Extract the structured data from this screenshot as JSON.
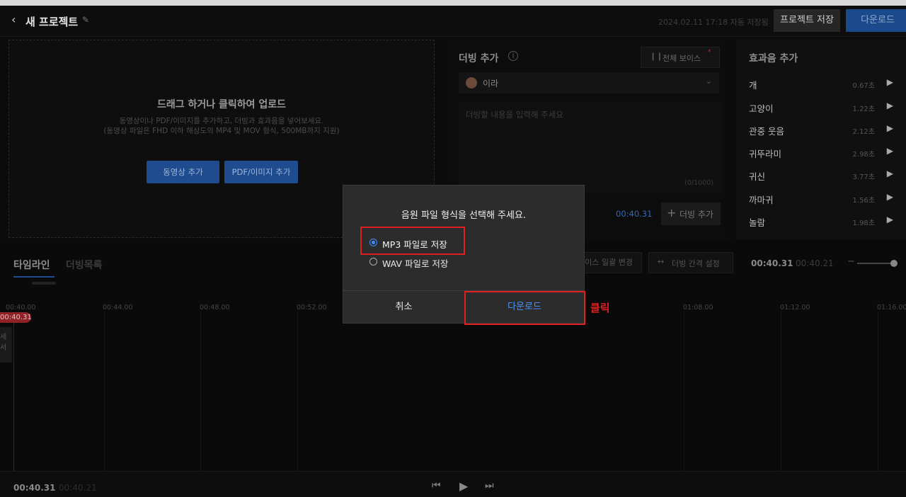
{
  "header": {
    "back_icon": "chevron-left-icon",
    "project_title": "새 프로젝트",
    "edit_icon": "pencil-icon",
    "autosave": "2024.02.11 17:18 자동 저장됨",
    "save_label": "프로젝트 저장",
    "download_label": "다운로드"
  },
  "upload": {
    "title": "드래그 하거나 클릭하여 업로드",
    "desc1": "동영상이나 PDF/이미지를 추가하고, 더빙과 효과음을 넣어보세요.",
    "desc2": "(동영상 파일은 FHD 이하 해상도의 MP4 및 MOV 형식, 500MB까지 지원)",
    "add_video": "동영상 추가",
    "add_pdf": "PDF/이미지 추가"
  },
  "dubbing": {
    "title": "더빙 추가",
    "info_icon": "info-icon",
    "all_voice": "전체 보이스",
    "voice_name": "이라",
    "placeholder": "더빙할 내용을 입력해 주세요",
    "counter": "(0/1000)",
    "time": "00:40.31",
    "add_label": "더빙 추가"
  },
  "sfx": {
    "title": "효과음 추가",
    "items": [
      {
        "name": "개",
        "dur": "0.67초"
      },
      {
        "name": "고양이",
        "dur": "1.22초"
      },
      {
        "name": "관중 웃음",
        "dur": "2.12초"
      },
      {
        "name": "귀뚜라미",
        "dur": "2.98초"
      },
      {
        "name": "귀신",
        "dur": "3.77초"
      },
      {
        "name": "까마귀",
        "dur": "1.56초"
      },
      {
        "name": "놀람",
        "dur": "1.98초"
      }
    ]
  },
  "timeline": {
    "tab_timeline": "타임라인",
    "tab_dublist": "더빙목록",
    "voice_bulk": "이스 일괄 변경",
    "interval": "더빙 간격 설정",
    "current": "00:40.31",
    "total": "00:40.21",
    "playhead": "00:40.31",
    "clip_label": "세서",
    "ticks": [
      "00:40.00",
      "00:44.00",
      "00:48.00",
      "00:52.00",
      "01:08.00",
      "01:12.00",
      "01:16.00"
    ]
  },
  "footer": {
    "current": "00:40.31",
    "total": "00:40.21"
  },
  "dialog": {
    "title": "음원 파일 형식을 선택해 주세요.",
    "option_mp3": "MP3 파일로 저장",
    "option_wav": "WAV 파일로 저장",
    "selected": "mp3",
    "cancel": "취소",
    "download": "다운로드"
  },
  "annotation": {
    "click_label": "클릭",
    "color": "#e02020"
  },
  "colors": {
    "accent": "#1e4c8f",
    "link": "#3b8cff",
    "playhead": "#c0262b"
  }
}
